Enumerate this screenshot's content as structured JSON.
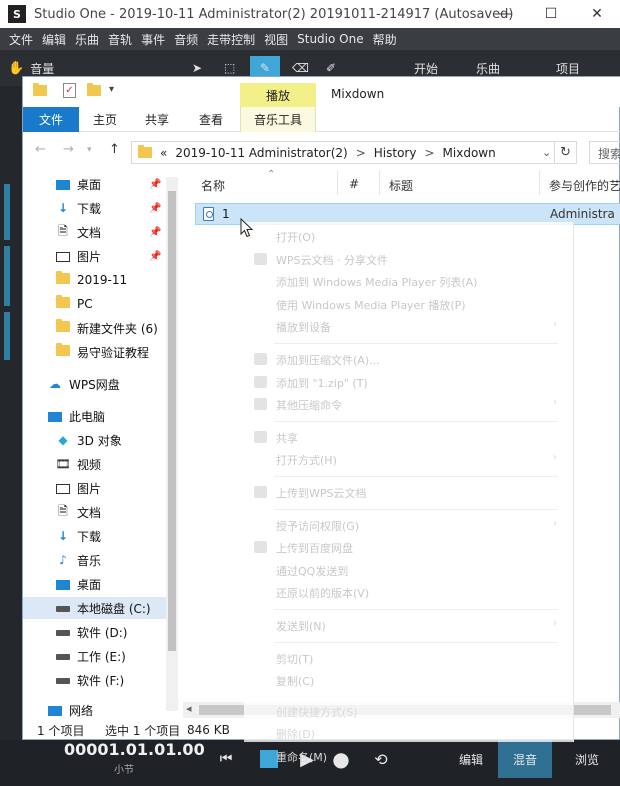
{
  "studio": {
    "title": "Studio One - 2019-10-11 Administrator(2) 20191011-214917 (Autosaved)",
    "menu": [
      "文件",
      "编辑",
      "乐曲",
      "音轨",
      "事件",
      "音频",
      "走带控制",
      "视图",
      "Studio One",
      "帮助"
    ],
    "toolbar": {
      "volume_label": "音量",
      "start_label": "开始",
      "song_label": "乐曲",
      "project_label": "项目"
    },
    "transport": {
      "time": "00001.01.01.00",
      "unit": "小节",
      "tabs": [
        "编辑",
        "混音",
        "浏览"
      ]
    }
  },
  "explorer": {
    "window_title": "Mixdown",
    "context_tab_group": "播放",
    "ribbon_tabs": [
      "文件",
      "主页",
      "共享",
      "查看",
      "音乐工具"
    ],
    "address": {
      "prefix": "«",
      "segments": [
        "2019-10-11 Administrator(2)",
        "History",
        "Mixdown"
      ],
      "separator": ">"
    },
    "search_placeholder": "搜索",
    "nav": {
      "quick_access": [
        {
          "label": "桌面",
          "pinned": true
        },
        {
          "label": "下载",
          "pinned": true
        },
        {
          "label": "文档",
          "pinned": true
        },
        {
          "label": "图片",
          "pinned": true
        },
        {
          "label": "2019-11",
          "pinned": false
        },
        {
          "label": "PC",
          "pinned": false
        },
        {
          "label": "新建文件夹 (6)",
          "pinned": false
        },
        {
          "label": "易守验证教程",
          "pinned": false
        }
      ],
      "wps": "WPS网盘",
      "this_pc": "此电脑",
      "pc_items": [
        "3D 对象",
        "视频",
        "图片",
        "文档",
        "下载",
        "音乐",
        "桌面",
        "本地磁盘 (C:)",
        "软件 (D:)",
        "工作 (E:)",
        "软件 (F:)"
      ],
      "selected_pc_item": "本地磁盘 (C:)",
      "network": "网络"
    },
    "columns": [
      "名称",
      "#",
      "标题",
      "参与创作的艺"
    ],
    "files": [
      {
        "name": "1",
        "author": "Administra"
      }
    ],
    "status": {
      "count": "1 个项目",
      "selected": "选中 1 个项目",
      "size": "846 KB"
    },
    "context_menu": [
      {
        "label": "打开(O)",
        "submenu": false,
        "icon": false
      },
      {
        "label": "WPS云文档 · 分享文件",
        "submenu": false,
        "icon": true
      },
      {
        "label": "添加到 Windows Media Player 列表(A)",
        "submenu": false,
        "icon": false
      },
      {
        "label": "使用 Windows Media Player 播放(P)",
        "submenu": false,
        "icon": false
      },
      {
        "label": "播放到设备",
        "submenu": true,
        "icon": false
      },
      {
        "sep": true
      },
      {
        "label": "添加到压缩文件(A)...",
        "submenu": false,
        "icon": true
      },
      {
        "label": "添加到 \"1.zip\" (T)",
        "submenu": false,
        "icon": true
      },
      {
        "label": "其他压缩命令",
        "submenu": true,
        "icon": true
      },
      {
        "sep": true
      },
      {
        "label": "共享",
        "submenu": false,
        "icon": true
      },
      {
        "label": "打开方式(H)",
        "submenu": true,
        "icon": false
      },
      {
        "sep": true
      },
      {
        "label": "上传到WPS云文档",
        "submenu": false,
        "icon": true
      },
      {
        "sep": true
      },
      {
        "label": "授予访问权限(G)",
        "submenu": true,
        "icon": false
      },
      {
        "label": "上传到百度网盘",
        "submenu": false,
        "icon": true
      },
      {
        "label": "通过QQ发送到",
        "submenu": false,
        "icon": false
      },
      {
        "label": "还原以前的版本(V)",
        "submenu": false,
        "icon": false
      },
      {
        "sep": true
      },
      {
        "label": "发送到(N)",
        "submenu": true,
        "icon": false
      },
      {
        "sep": true
      },
      {
        "label": "剪切(T)",
        "submenu": false,
        "icon": false
      },
      {
        "label": "复制(C)",
        "submenu": false,
        "icon": false
      }
    ],
    "context_menu_tail": [
      "创建快捷方式(S)",
      "删除(D)",
      "重命名(M)"
    ]
  },
  "colors": {
    "studio_bg": "#3a3d42",
    "ribbon_file_blue": "#1979ca",
    "context_tab_yellow": "#f3f08a",
    "selection_blue": "#cce4f7",
    "transport_accent": "#3fa7d8"
  }
}
